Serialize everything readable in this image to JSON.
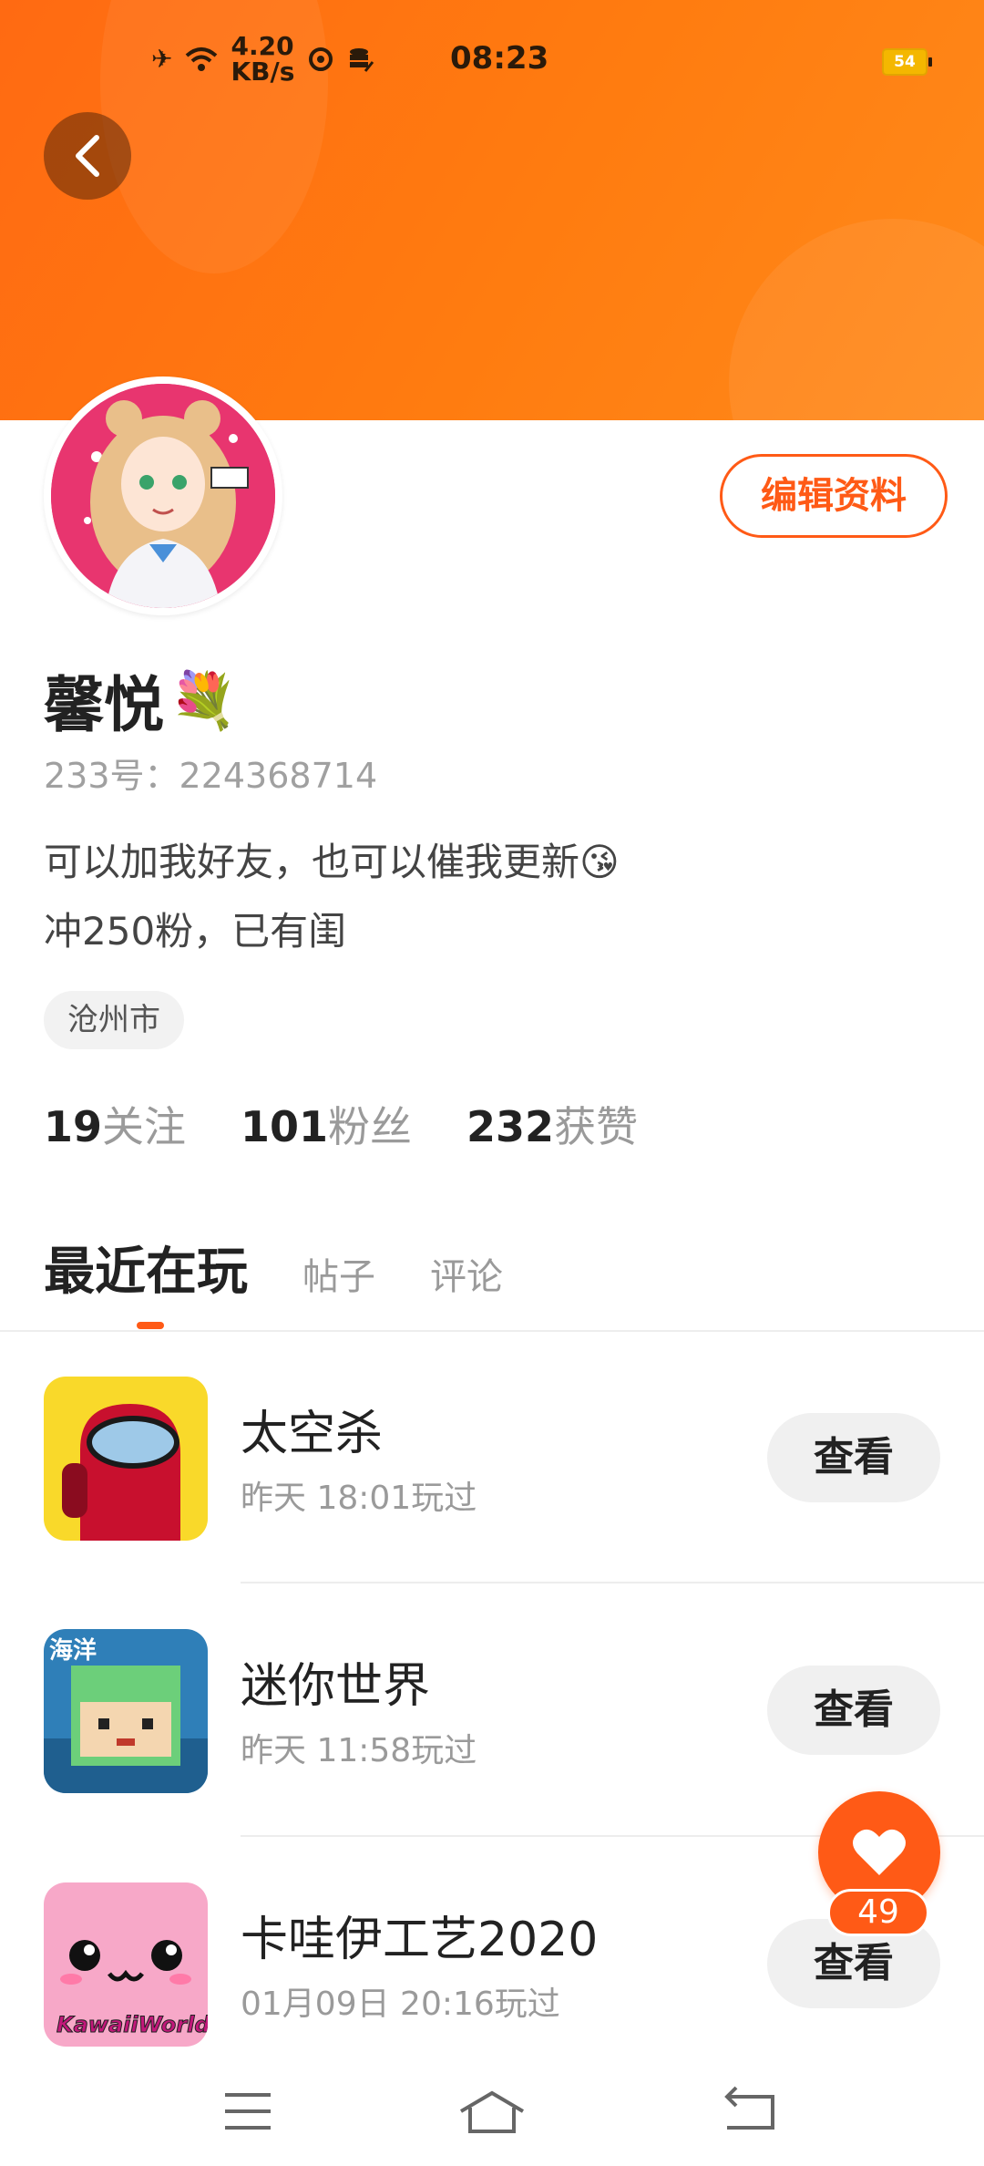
{
  "status_bar": {
    "speed_value": "4.20",
    "speed_unit": "KB/s",
    "time": "08:23",
    "battery": "54"
  },
  "profile": {
    "edit_label": "编辑资料",
    "name": "馨悦",
    "name_emoji": "💐",
    "uid": "233号：224368714",
    "bio_line1": "可以加我好友，也可以催我更新😘",
    "bio_line2": "冲250粉，已有闺",
    "location": "沧州市",
    "stats": {
      "following_count": "19",
      "following_label": "关注",
      "fans_count": "101",
      "fans_label": "粉丝",
      "likes_count": "232",
      "likes_label": "获赞"
    }
  },
  "tabs": [
    {
      "label": "最近在玩"
    },
    {
      "label": "帖子"
    },
    {
      "label": "评论"
    }
  ],
  "games": [
    {
      "name": "太空杀",
      "time": "昨天 18:01玩过",
      "action": "查看",
      "icon": "among-us-icon"
    },
    {
      "name": "迷你世界",
      "time": "昨天 11:58玩过",
      "action": "查看",
      "icon": "mini-world-icon",
      "icon_text": "海洋"
    },
    {
      "name": "卡哇伊工艺2020",
      "time": "01月09日 20:16玩过",
      "action": "查看",
      "icon": "kawaii-world-icon",
      "icon_text": "KawaiiWorld"
    }
  ],
  "fab": {
    "icon": "heart-icon",
    "count": "49"
  },
  "colors": {
    "accent": "#ff5a16",
    "header": "#ff7410"
  }
}
